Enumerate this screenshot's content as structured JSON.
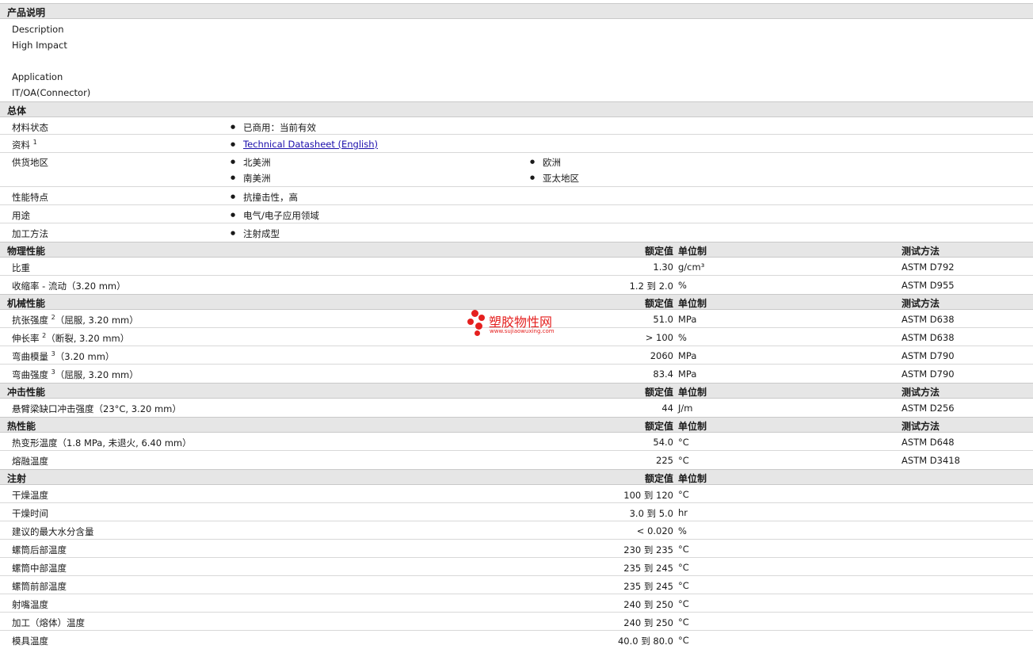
{
  "sections": {
    "product": "产品说明",
    "general": "总体",
    "physical": "物理性能",
    "mechanical": "机械性能",
    "impact": "冲击性能",
    "thermal": "热性能",
    "injection": "注射"
  },
  "headers": {
    "value": "额定值",
    "unit": "单位制",
    "test": "测试方法"
  },
  "description": {
    "desc_label": "Description",
    "desc_value": "High Impact",
    "app_label": "Application",
    "app_value": "IT/OA(Connector)"
  },
  "general": {
    "status_label": "材料状态",
    "status_value": "已商用：当前有效",
    "doc_label": "资料",
    "doc_sup": "1",
    "doc_link": "Technical Datasheet (English)",
    "supply_label": "供货地区",
    "supply": [
      "北美洲",
      "欧洲",
      "南美洲",
      "亚太地区"
    ],
    "feature_label": "性能特点",
    "feature_value": "抗撞击性，高",
    "use_label": "用途",
    "use_value": "电气/电子应用领域",
    "process_label": "加工方法",
    "process_value": "注射成型"
  },
  "physical": [
    {
      "label": "比重",
      "value": "1.30",
      "unit": "g/cm³",
      "test": "ASTM D792"
    },
    {
      "label": "收缩率 - 流动（3.20 mm）",
      "value": "1.2 到  2.0",
      "unit": "%",
      "test": "ASTM D955"
    }
  ],
  "mechanical": [
    {
      "label_a": "抗张强度",
      "sup": "2",
      "label_b": "（屈服, 3.20 mm）",
      "value": "51.0",
      "unit": "MPa",
      "test": "ASTM D638"
    },
    {
      "label_a": "伸长率",
      "sup": "2",
      "label_b": "（断裂, 3.20 mm）",
      "value": "> 100",
      "unit": "%",
      "test": "ASTM D638"
    },
    {
      "label_a": "弯曲模量",
      "sup": "3",
      "label_b": "（3.20 mm）",
      "value": "2060",
      "unit": "MPa",
      "test": "ASTM D790"
    },
    {
      "label_a": "弯曲强度",
      "sup": "3",
      "label_b": "（屈服, 3.20 mm）",
      "value": "83.4",
      "unit": "MPa",
      "test": "ASTM D790"
    }
  ],
  "impact": [
    {
      "label": "悬臂梁缺口冲击强度（23°C, 3.20 mm）",
      "value": "44",
      "unit": "J/m",
      "test": "ASTM D256"
    }
  ],
  "thermal": [
    {
      "label": "热变形温度（1.8 MPa, 未退火, 6.40 mm）",
      "value": "54.0",
      "unit": "°C",
      "test": "ASTM D648"
    },
    {
      "label": "熔融温度",
      "value": "225",
      "unit": "°C",
      "test": "ASTM D3418"
    }
  ],
  "injection": [
    {
      "label": "干燥温度",
      "value": "100 到  120",
      "unit": "°C"
    },
    {
      "label": "干燥时间",
      "value": "3.0 到  5.0",
      "unit": "hr"
    },
    {
      "label": "建议的最大水分含量",
      "value": "< 0.020",
      "unit": "%"
    },
    {
      "label": "螺筒后部温度",
      "value": "230 到  235",
      "unit": "°C"
    },
    {
      "label": "螺筒中部温度",
      "value": "235 到  245",
      "unit": "°C"
    },
    {
      "label": "螺筒前部温度",
      "value": "235 到  245",
      "unit": "°C"
    },
    {
      "label": "射嘴温度",
      "value": "240 到  250",
      "unit": "°C"
    },
    {
      "label": "加工（熔体）温度",
      "value": "240 到  250",
      "unit": "°C"
    },
    {
      "label": "模具温度",
      "value": "40.0 到  80.0",
      "unit": "°C"
    }
  ],
  "watermark": {
    "cn": "塑胶物性网",
    "en": "www.sujiaowuxing.com",
    "color": "#e5201f"
  }
}
